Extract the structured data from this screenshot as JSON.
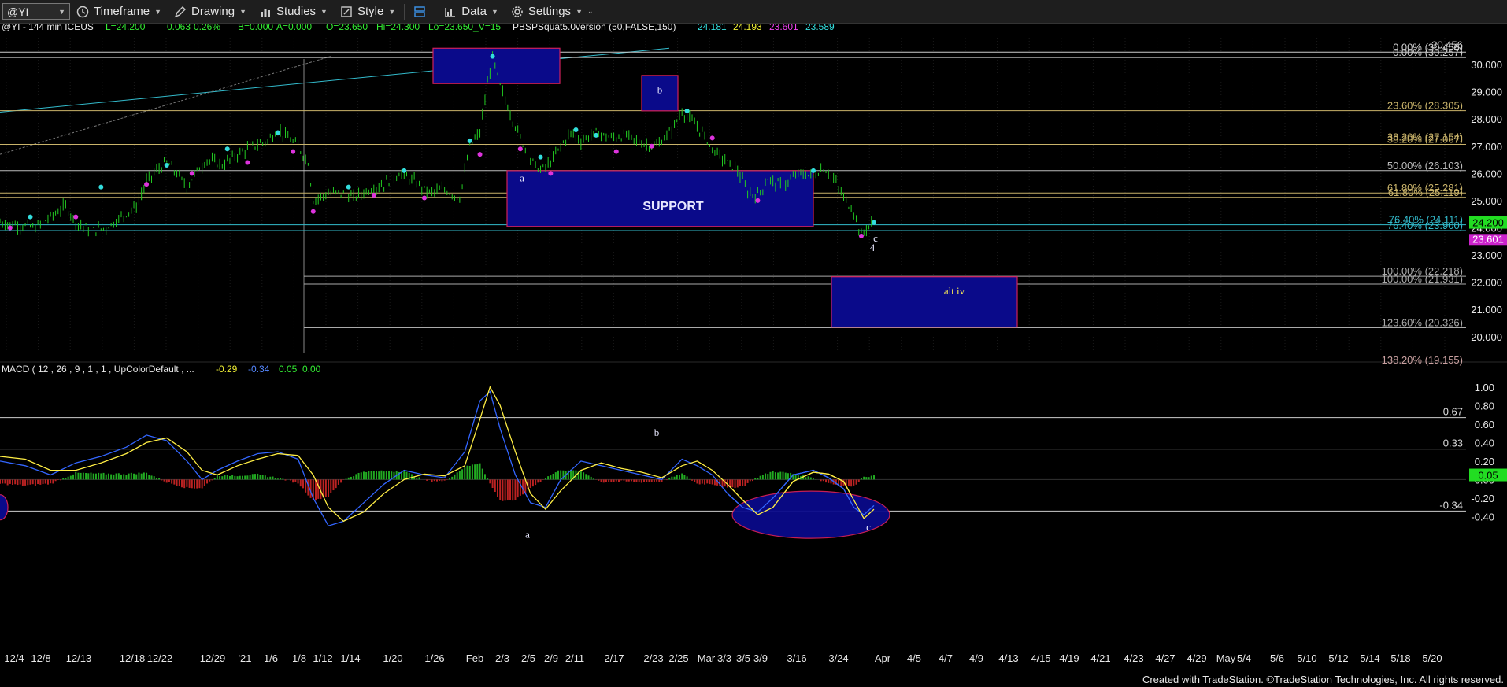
{
  "toolbar": {
    "symbol": "@YI",
    "timeframe": "Timeframe",
    "drawing": "Drawing",
    "studies": "Studies",
    "style": "Style",
    "data": "Data",
    "settings": "Settings"
  },
  "header": {
    "symbol_info": "@YI - 144 min  ICEUS",
    "L": "L=24.200",
    "chg": "0.063",
    "pct": "0.26%",
    "B": "B=0.000",
    "A": "A=0.000",
    "O": "O=23.650",
    "Hi": "Hi=24.300",
    "LoV": "Lo=23.650_V=15",
    "study": "PBSPSquat5.0version (50,FALSE,150)",
    "v1": "24.181",
    "v2": "24.193",
    "v3": "23.601",
    "v4": "23.589"
  },
  "macd_header": {
    "label": "MACD ( 12 , 26 , 9 , 1 , 1 , UpColorDefault , ...",
    "v1": "-0.29",
    "v2": "-0.34",
    "v3": "0.05",
    "v4": "0.00"
  },
  "colors": {
    "price_bar": "#22cc22",
    "cyan_dot": "#33dddd",
    "magenta_dot": "#dd33dd",
    "zone_fill": "#0a0a8a",
    "zone_border": "#d0205a",
    "trendline": "#33bbcc",
    "macd_line": "#3366ff",
    "signal_line": "#ffee44",
    "hist_pos": "#22aa22",
    "hist_neg": "#bb2222",
    "last_price_bg": "#22dd22",
    "last_low_bg": "#cc22cc"
  },
  "labels": {
    "support": "SUPPORT",
    "a_price": "a",
    "b_price": "b",
    "c_price": "c",
    "four": "4",
    "alt_iv": "alt iv",
    "a_macd": "a",
    "b_macd": "b",
    "c_macd": "c"
  },
  "credit": "Created with TradeStation. ©TradeStation Technologies, Inc. All rights reserved.",
  "chart_data": [
    {
      "type": "candlestick",
      "title": "@YI - 144 min ICEUS",
      "x_tick_labels": [
        "12/4",
        "12/8",
        "12/13",
        "12/18",
        "12/22",
        "12/29",
        "'21",
        "1/6",
        "1/8",
        "1/12",
        "1/14",
        "1/20",
        "1/26",
        "Feb",
        "2/3",
        "2/5",
        "2/9",
        "2/11",
        "2/17",
        "2/23",
        "2/25",
        "Mar",
        "3/3",
        "3/5",
        "3/9",
        "3/16",
        "3/24",
        "Apr",
        "4/5",
        "4/7",
        "4/9",
        "4/13",
        "4/15",
        "4/19",
        "4/21",
        "4/23",
        "4/27",
        "4/29",
        "May",
        "5/4",
        "5/6",
        "5/10",
        "5/12",
        "5/14",
        "5/18",
        "5/20"
      ],
      "y_tick_labels": [
        "30.000",
        "29.000",
        "28.000",
        "27.000",
        "26.000",
        "25.000",
        "24.000",
        "23.000",
        "22.000",
        "21.000",
        "20.000"
      ],
      "ylim": [
        19.3,
        31.1
      ],
      "last_price": "24.200",
      "last_low": "23.601",
      "path": [
        [
          0,
          24.2
        ],
        [
          8,
          24.1
        ],
        [
          14,
          24.0
        ],
        [
          20,
          24.4
        ],
        [
          26,
          24.8
        ],
        [
          30,
          24.2
        ],
        [
          36,
          23.9
        ],
        [
          42,
          24.0
        ],
        [
          48,
          24.4
        ],
        [
          54,
          24.8
        ],
        [
          58,
          25.7
        ],
        [
          62,
          26.1
        ],
        [
          66,
          26.4
        ],
        [
          70,
          26.0
        ],
        [
          74,
          25.5
        ],
        [
          78,
          26.1
        ],
        [
          82,
          26.5
        ],
        [
          88,
          26.3
        ],
        [
          94,
          26.7
        ],
        [
          100,
          27.0
        ],
        [
          106,
          27.2
        ],
        [
          110,
          27.6
        ],
        [
          114,
          27.3
        ],
        [
          118,
          27.0
        ],
        [
          122,
          26.4
        ],
        [
          124,
          25.0
        ],
        [
          128,
          25.2
        ],
        [
          134,
          25.3
        ],
        [
          140,
          25.1
        ],
        [
          146,
          25.4
        ],
        [
          152,
          25.6
        ],
        [
          158,
          26.0
        ],
        [
          164,
          25.7
        ],
        [
          170,
          25.3
        ],
        [
          176,
          25.4
        ],
        [
          182,
          25.1
        ],
        [
          186,
          27.0
        ],
        [
          190,
          27.5
        ],
        [
          193,
          29.3
        ],
        [
          195,
          30.3
        ],
        [
          198,
          29.2
        ],
        [
          202,
          28.2
        ],
        [
          206,
          27.3
        ],
        [
          210,
          26.5
        ],
        [
          214,
          26.1
        ],
        [
          218,
          26.4
        ],
        [
          222,
          27.0
        ],
        [
          226,
          27.5
        ],
        [
          230,
          27.2
        ],
        [
          236,
          27.5
        ],
        [
          242,
          27.3
        ],
        [
          248,
          27.4
        ],
        [
          254,
          27.1
        ],
        [
          260,
          27.0
        ],
        [
          266,
          27.6
        ],
        [
          270,
          28.3
        ],
        [
          274,
          27.9
        ],
        [
          278,
          27.5
        ],
        [
          282,
          26.9
        ],
        [
          288,
          26.4
        ],
        [
          292,
          26.1
        ],
        [
          296,
          25.3
        ],
        [
          300,
          25.2
        ],
        [
          304,
          25.8
        ],
        [
          310,
          25.5
        ],
        [
          316,
          26.0
        ],
        [
          322,
          25.9
        ],
        [
          326,
          26.2
        ],
        [
          330,
          25.8
        ],
        [
          334,
          25.1
        ],
        [
          338,
          24.6
        ],
        [
          341,
          23.7
        ],
        [
          343,
          24.0
        ],
        [
          346,
          24.2
        ]
      ],
      "swing_high_dots": [
        [
          12,
          24.4
        ],
        [
          40,
          25.5
        ],
        [
          66,
          26.3
        ],
        [
          90,
          26.9
        ],
        [
          110,
          27.5
        ],
        [
          138,
          25.5
        ],
        [
          160,
          26.1
        ],
        [
          186,
          27.2
        ],
        [
          195,
          30.3
        ],
        [
          214,
          26.6
        ],
        [
          228,
          27.6
        ],
        [
          236,
          27.4
        ],
        [
          272,
          28.3
        ],
        [
          322,
          26.1
        ],
        [
          346,
          24.2
        ]
      ],
      "swing_low_dots": [
        [
          4,
          24.0
        ],
        [
          30,
          24.4
        ],
        [
          58,
          25.6
        ],
        [
          76,
          26.0
        ],
        [
          98,
          26.4
        ],
        [
          116,
          26.8
        ],
        [
          124,
          24.6
        ],
        [
          148,
          25.2
        ],
        [
          168,
          25.1
        ],
        [
          190,
          26.7
        ],
        [
          206,
          26.9
        ],
        [
          218,
          26.0
        ],
        [
          244,
          26.8
        ],
        [
          258,
          27.0
        ],
        [
          282,
          27.3
        ],
        [
          300,
          25.0
        ],
        [
          341,
          23.7
        ]
      ],
      "fib_levels": [
        {
          "label": "0.00% (30.456)",
          "value": 30.456
        },
        {
          "label": "0.00% (30.257)",
          "value": 30.257
        },
        {
          "label": "23.60% (28.305)",
          "value": 28.305
        },
        {
          "label": "38.20% (27.154)",
          "value": 27.154
        },
        {
          "label": "38.20% (27.067)",
          "value": 27.067
        },
        {
          "label": "50.00% (26.103)",
          "value": 26.103
        },
        {
          "label": "61.80% (25.281)",
          "value": 25.281
        },
        {
          "label": "61.80% (25.119)",
          "value": 25.119
        },
        {
          "label": "76.40% (24.111)",
          "value": 24.111
        },
        {
          "label": "76.40% (23.900)",
          "value": 23.9
        },
        {
          "label": "100.00% (22.218)",
          "value": 22.218
        },
        {
          "label": "100.00% (21.931)",
          "value": 21.931
        },
        {
          "label": "123.60% (20.326)",
          "value": 20.326
        },
        {
          "label": "138.20% (19.155)",
          "value": 19.155
        }
      ],
      "top_right_label": "30.456"
    },
    {
      "type": "line",
      "title": "MACD ( 12 , 26 , 9 , 1 , 1 , UpColorDefault , ...",
      "y_tick_labels": [
        "1.00",
        "0.80",
        "0.60",
        "0.40",
        "0.20",
        "0.00",
        "-0.20",
        "-0.40"
      ],
      "ylim": [
        -0.6,
        1.1
      ],
      "h_levels": [
        {
          "label": "0.67",
          "value": 0.67
        },
        {
          "label": "0.33",
          "value": 0.33
        },
        {
          "label": "-0.34",
          "value": -0.34
        }
      ],
      "last_value": "0.05",
      "macd": [
        [
          0,
          0.2
        ],
        [
          10,
          0.15
        ],
        [
          20,
          0.05
        ],
        [
          30,
          0.18
        ],
        [
          40,
          0.25
        ],
        [
          50,
          0.35
        ],
        [
          58,
          0.48
        ],
        [
          66,
          0.42
        ],
        [
          74,
          0.2
        ],
        [
          80,
          0.0
        ],
        [
          86,
          0.1
        ],
        [
          94,
          0.2
        ],
        [
          102,
          0.28
        ],
        [
          110,
          0.3
        ],
        [
          118,
          0.22
        ],
        [
          124,
          -0.2
        ],
        [
          130,
          -0.5
        ],
        [
          136,
          -0.45
        ],
        [
          144,
          -0.25
        ],
        [
          152,
          -0.05
        ],
        [
          160,
          0.1
        ],
        [
          168,
          0.05
        ],
        [
          176,
          0.02
        ],
        [
          184,
          0.3
        ],
        [
          190,
          0.85
        ],
        [
          194,
          0.95
        ],
        [
          198,
          0.55
        ],
        [
          204,
          0.05
        ],
        [
          210,
          -0.25
        ],
        [
          216,
          -0.3
        ],
        [
          222,
          0.0
        ],
        [
          230,
          0.2
        ],
        [
          238,
          0.15
        ],
        [
          246,
          0.1
        ],
        [
          254,
          0.05
        ],
        [
          262,
          0.0
        ],
        [
          270,
          0.22
        ],
        [
          276,
          0.15
        ],
        [
          282,
          0.05
        ],
        [
          288,
          -0.15
        ],
        [
          294,
          -0.3
        ],
        [
          300,
          -0.35
        ],
        [
          306,
          -0.2
        ],
        [
          314,
          0.05
        ],
        [
          322,
          0.1
        ],
        [
          328,
          0.02
        ],
        [
          334,
          -0.1
        ],
        [
          338,
          -0.3
        ],
        [
          342,
          -0.38
        ],
        [
          346,
          -0.28
        ]
      ],
      "signal": [
        [
          0,
          0.25
        ],
        [
          10,
          0.22
        ],
        [
          20,
          0.1
        ],
        [
          30,
          0.1
        ],
        [
          40,
          0.18
        ],
        [
          50,
          0.28
        ],
        [
          58,
          0.4
        ],
        [
          66,
          0.45
        ],
        [
          74,
          0.3
        ],
        [
          80,
          0.1
        ],
        [
          86,
          0.05
        ],
        [
          94,
          0.15
        ],
        [
          102,
          0.22
        ],
        [
          110,
          0.28
        ],
        [
          118,
          0.26
        ],
        [
          124,
          0.05
        ],
        [
          130,
          -0.3
        ],
        [
          136,
          -0.45
        ],
        [
          144,
          -0.35
        ],
        [
          152,
          -0.15
        ],
        [
          160,
          0.0
        ],
        [
          168,
          0.06
        ],
        [
          176,
          0.04
        ],
        [
          184,
          0.15
        ],
        [
          190,
          0.65
        ],
        [
          194,
          1.0
        ],
        [
          198,
          0.8
        ],
        [
          204,
          0.3
        ],
        [
          210,
          -0.15
        ],
        [
          216,
          -0.32
        ],
        [
          222,
          -0.12
        ],
        [
          230,
          0.1
        ],
        [
          238,
          0.18
        ],
        [
          246,
          0.12
        ],
        [
          254,
          0.08
        ],
        [
          262,
          0.02
        ],
        [
          270,
          0.15
        ],
        [
          276,
          0.2
        ],
        [
          282,
          0.1
        ],
        [
          288,
          -0.05
        ],
        [
          294,
          -0.22
        ],
        [
          300,
          -0.38
        ],
        [
          306,
          -0.3
        ],
        [
          314,
          -0.02
        ],
        [
          322,
          0.08
        ],
        [
          328,
          0.06
        ],
        [
          334,
          -0.02
        ],
        [
          338,
          -0.22
        ],
        [
          342,
          -0.42
        ],
        [
          346,
          -0.32
        ]
      ]
    }
  ]
}
